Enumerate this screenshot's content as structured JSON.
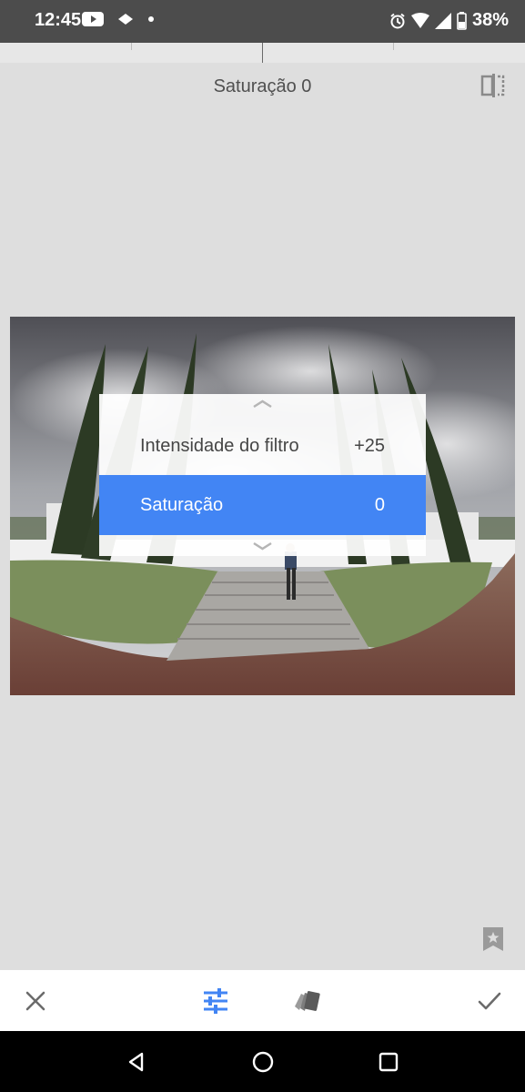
{
  "status_bar": {
    "time": "12:45",
    "battery": "38%",
    "icons": [
      "youtube-icon",
      "cloud-icon",
      "dot-icon",
      "alarm-icon",
      "wifi-icon",
      "signal-icon",
      "battery-icon"
    ]
  },
  "header": {
    "title": "Saturação 0",
    "compare_icon": "compare-split-icon"
  },
  "adjust_menu": {
    "items": [
      {
        "label": "Intensidade do filtro",
        "value": "+25"
      },
      {
        "label": "Saturação",
        "value": "0"
      }
    ],
    "selected_index": 1
  },
  "bottom_toolbar": {
    "cancel_icon": "close-icon",
    "tune_icon": "tune-sliders-icon",
    "styles_icon": "styles-cards-icon",
    "apply_icon": "checkmark-icon"
  },
  "colors": {
    "accent": "#4285f4",
    "background": "#dedede",
    "statusbar": "#4c4c4c",
    "navbar": "#000000"
  }
}
